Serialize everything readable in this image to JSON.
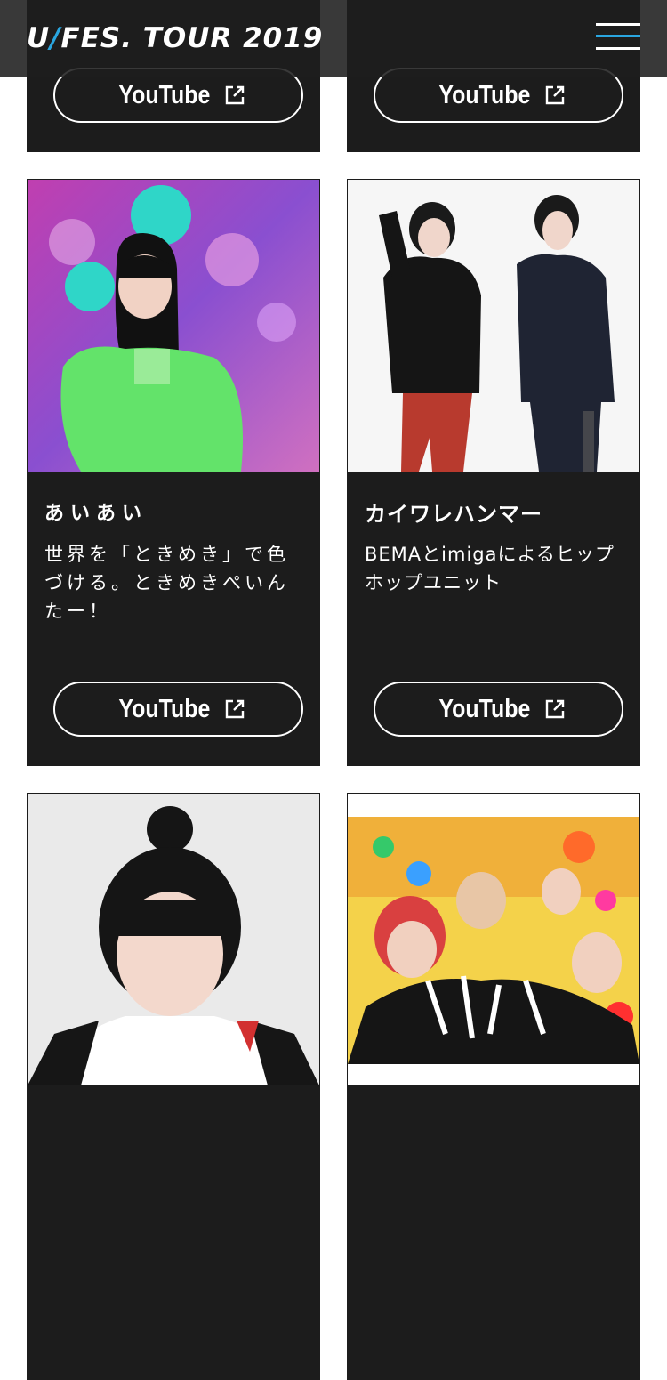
{
  "header": {
    "logo_main": "U",
    "logo_rest": "FES. TOUR 2019",
    "menu_icon": "hamburger-menu-icon"
  },
  "colors": {
    "header_bg": "#1e1e1e",
    "card_bg": "#1c1c1c",
    "accent": "#2aa6e0",
    "text": "#ffffff"
  },
  "artists": [
    {
      "name": "",
      "description": "",
      "youtube_label": "YouTube",
      "link_icon": "external-link-icon"
    },
    {
      "name": "",
      "description": "",
      "youtube_label": "YouTube",
      "link_icon": "external-link-icon"
    },
    {
      "name": "あいあい",
      "description": "世界を「ときめき」で色づける。ときめきぺいんたー！",
      "youtube_label": "YouTube",
      "link_icon": "external-link-icon"
    },
    {
      "name": "カイワレハンマー",
      "description": "BEMAとimigaによるヒップホップユニット",
      "youtube_label": "YouTube",
      "link_icon": "external-link-icon"
    },
    {
      "name": "",
      "description": "",
      "youtube_label": "",
      "link_icon": ""
    },
    {
      "name": "",
      "description": "",
      "youtube_label": "",
      "link_icon": ""
    }
  ]
}
